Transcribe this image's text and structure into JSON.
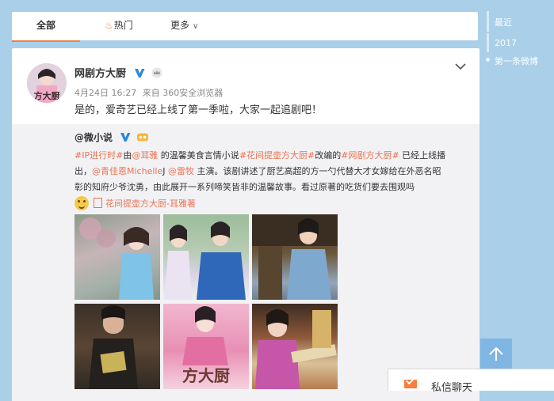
{
  "tabs": {
    "all": "全部",
    "hot": "热门",
    "more": "更多"
  },
  "timeline": {
    "recent": "最近",
    "year": "2017",
    "first": "第一条微博"
  },
  "post": {
    "author": "网剧方大厨",
    "date": "4月24日 16:27",
    "source": "来自 360安全浏览器",
    "text": "是的，爱奇艺已经上线了第一季啦，大家一起追剧吧！",
    "avatar_caption": "方大厨"
  },
  "repost": {
    "author": "@微小说",
    "segments": [
      {
        "text": "#IP进行时#",
        "link": true
      },
      {
        "text": "由",
        "link": false
      },
      {
        "text": "@耳雅",
        "link": true
      },
      {
        "text": " 的温馨美食言情小说",
        "link": false
      },
      {
        "text": "#花间提壶方大厨#",
        "link": true
      },
      {
        "text": "改编的",
        "link": false
      },
      {
        "text": "#网剧方大厨#",
        "link": true
      },
      {
        "text": " 已经上线播出，",
        "link": false
      },
      {
        "text": "@青佳恩Michelle",
        "link": true
      },
      {
        "text": "J ",
        "link": false
      },
      {
        "text": "@雷牧",
        "link": true
      },
      {
        "text": " 主演。该剧讲述了厨艺高超的方一勺代替大才女嫁给在外恶名昭彰的知府少爷沈勇，由此展开一系列啼笑皆非的温馨故事。看过原著的吃货们要去围观吗",
        "link": false
      }
    ],
    "link_text": "花间提壶方大厨-耳雅著",
    "poster_title": "方大厨"
  },
  "chat": {
    "label": "私信聊天"
  },
  "colors": {
    "accent": "#fa7d3c",
    "link": "#eb7350",
    "background": "#a9cfe9"
  }
}
